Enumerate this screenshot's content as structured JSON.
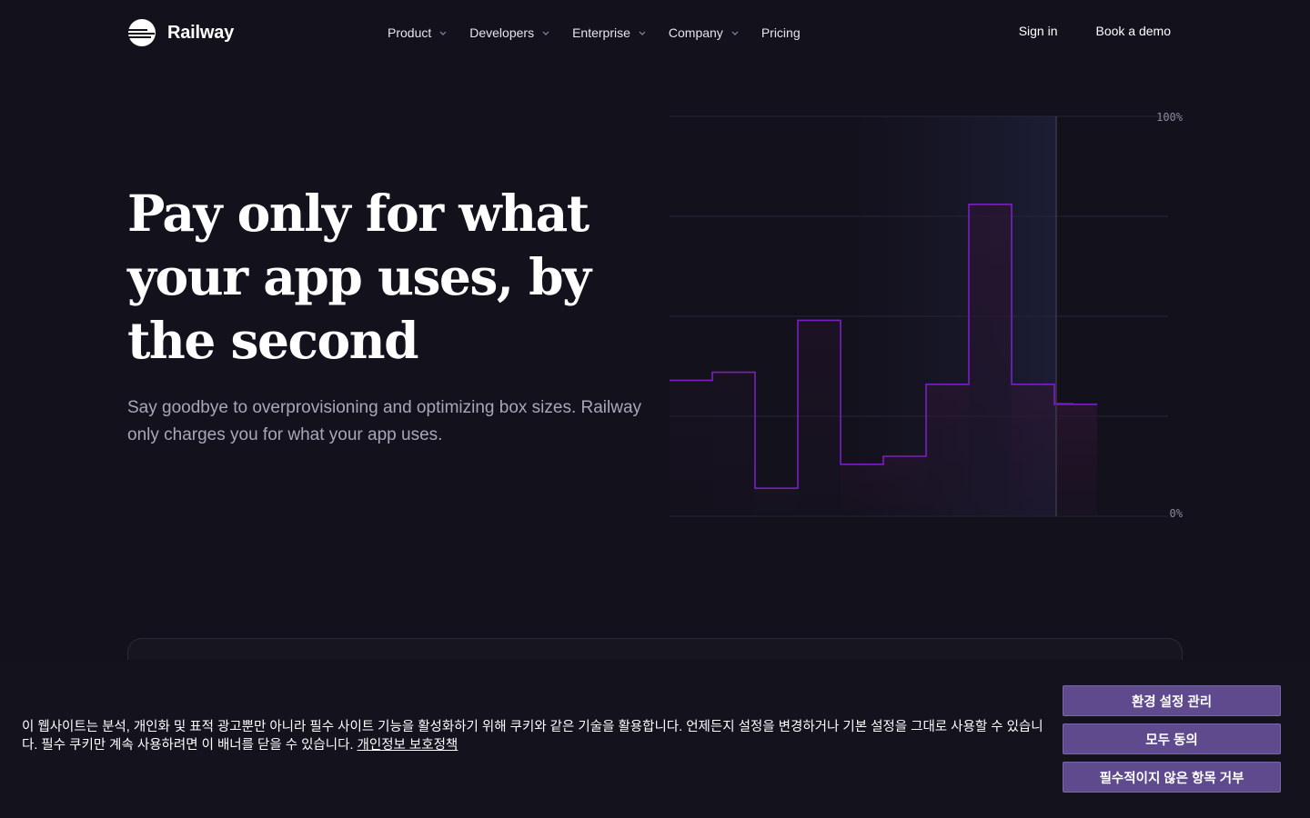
{
  "nav": {
    "brand": "Railway",
    "menu": [
      {
        "label": "Product",
        "has_dropdown": true
      },
      {
        "label": "Developers",
        "has_dropdown": true
      },
      {
        "label": "Enterprise",
        "has_dropdown": true
      },
      {
        "label": "Company",
        "has_dropdown": true
      },
      {
        "label": "Pricing",
        "has_dropdown": false
      }
    ],
    "sign_in": "Sign in",
    "book_demo": "Book a demo"
  },
  "hero": {
    "title": "Pay only for what your app uses, by the second",
    "subtitle": "Say goodbye to overprovisioning and optimizing box sizes. Railway only charges you for what your app uses."
  },
  "usage_chart": {
    "top_label": "100%",
    "bottom_label": "0%",
    "usage_levels_percent": [
      34,
      36,
      7,
      49,
      13,
      15,
      33,
      78,
      33,
      28
    ],
    "line_color": "#7a1fc2",
    "fill_color": "#2a1630",
    "highlight_color": "#1a1a2e"
  },
  "cookie_banner": {
    "text": "이 웹사이트는 분석, 개인화 및 표적 광고뿐만 아니라 필수 사이트 기능을 활성화하기 위해 쿠키와 같은 기술을 활용합니다. 언제든지 설정을 변경하거나 기본 설정을 그대로 사용할 수 있습니다. 필수 쿠키만 계속 사용하려면 이 배너를 닫을 수 있습니다. ",
    "link": "개인정보 보호정책",
    "buttons": {
      "manage": "환경 설정 관리",
      "accept_all": "모두 동의",
      "reject": "필수적이지 않은 항목 거부"
    },
    "button_color": "#5e4a8c"
  }
}
